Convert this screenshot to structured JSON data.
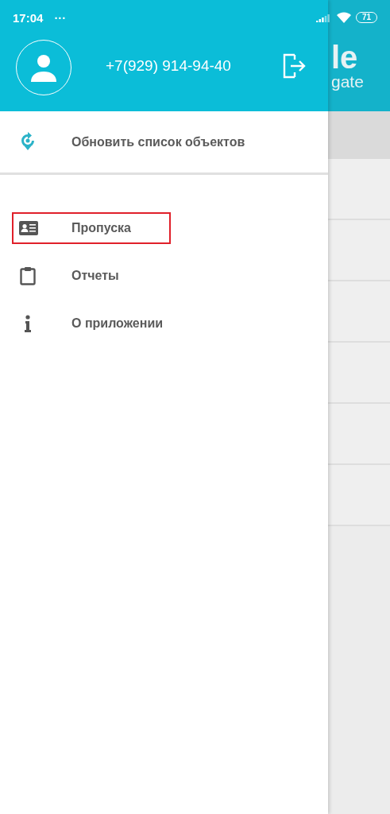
{
  "status_bar": {
    "time": "17:04",
    "dots": "···",
    "battery": "71"
  },
  "drawer": {
    "phone": "+7(929) 914-94-40",
    "top_item": {
      "label": "Обновить список объектов"
    },
    "items": [
      {
        "label": "Пропуска",
        "highlighted": true
      },
      {
        "label": "Отчеты",
        "highlighted": false
      },
      {
        "label": "О приложении",
        "highlighted": false
      }
    ]
  },
  "background_app": {
    "title_part": "le",
    "subtitle_part": "gate"
  }
}
